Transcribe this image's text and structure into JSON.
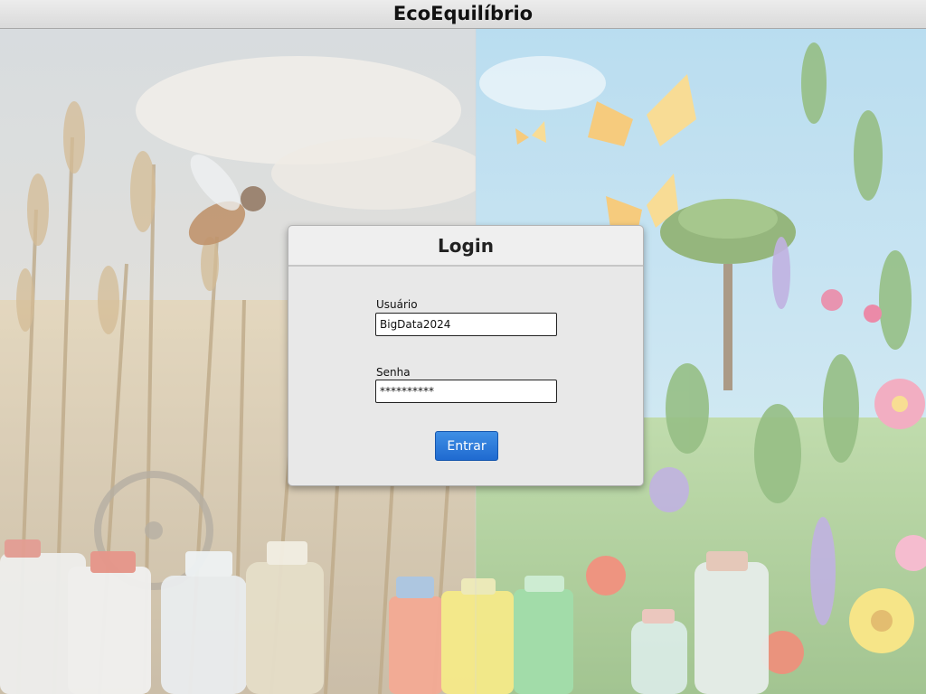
{
  "app": {
    "title": "EcoEquilíbrio"
  },
  "login": {
    "heading": "Login",
    "username_label": "Usuário",
    "username_value": "BigData2024",
    "password_label": "Senha",
    "password_value": "**********",
    "submit_label": "Entrar"
  },
  "colors": {
    "accent_button": "#2a7bdc",
    "titlebar": "#e0e0e0",
    "dialog_bg": "#e8e8e8"
  },
  "background": {
    "description_icons": [
      "dead-crops",
      "bee-icon",
      "butterfly-icon",
      "tree-icon",
      "flower-icon",
      "chemical-bottles"
    ]
  }
}
